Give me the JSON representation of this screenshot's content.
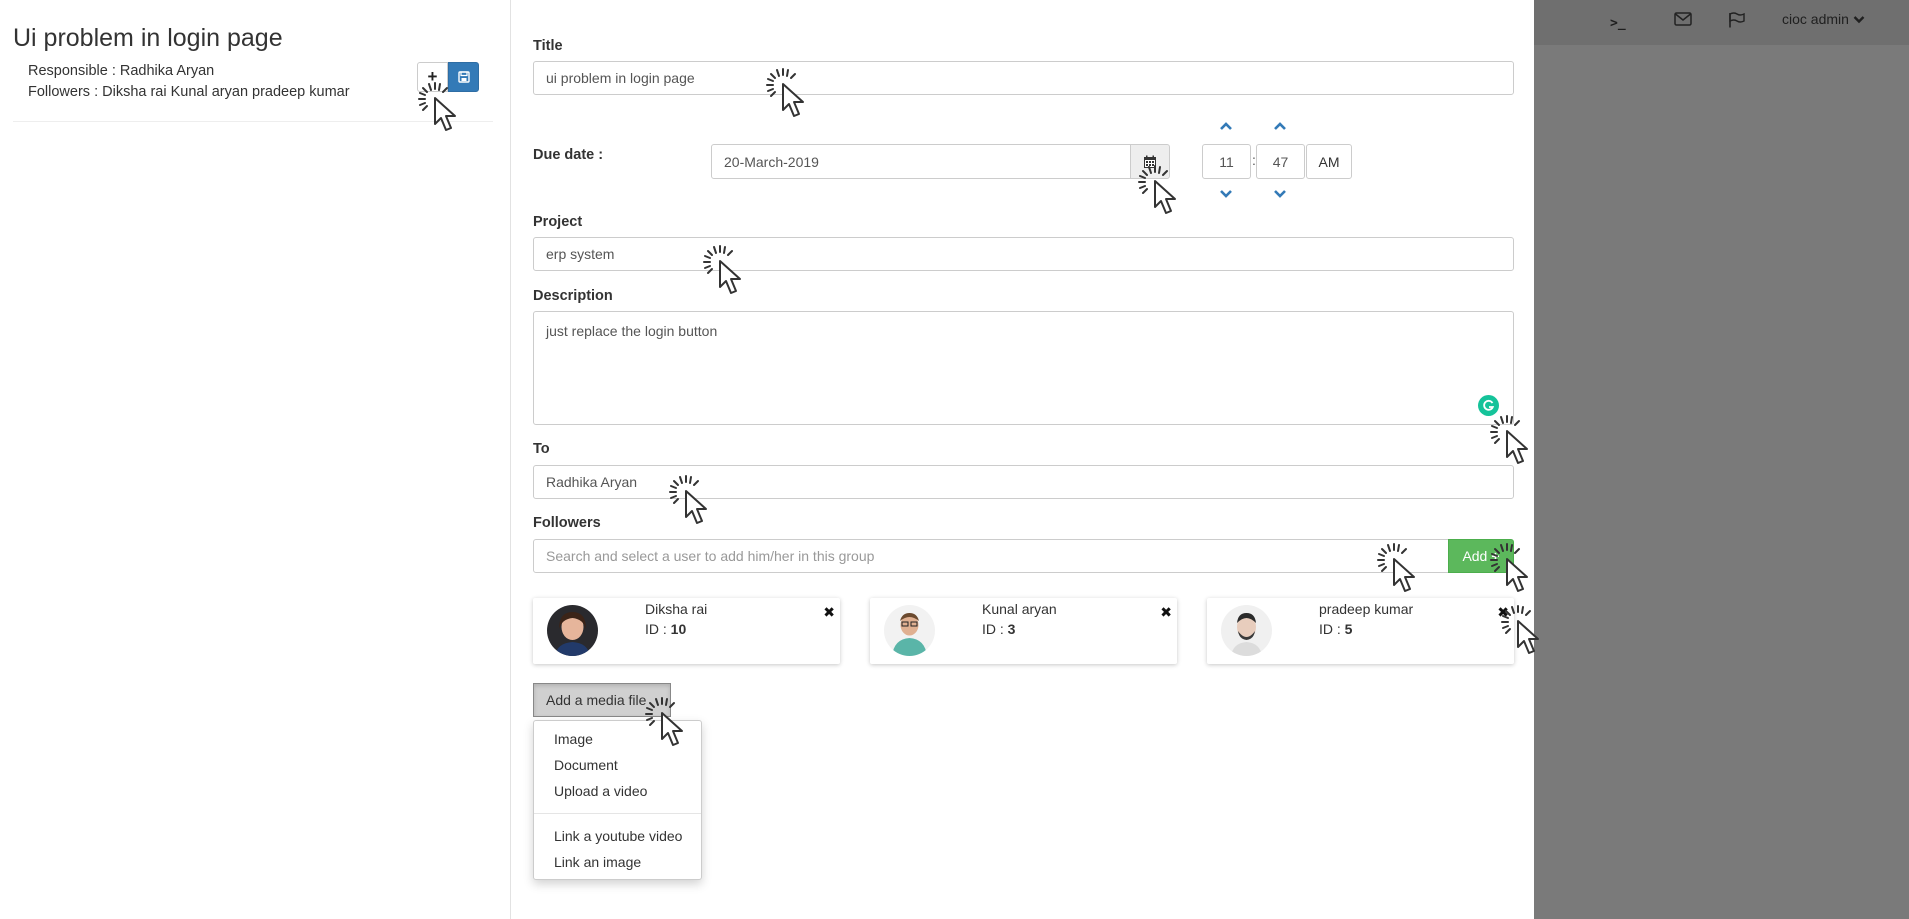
{
  "left": {
    "title": "Ui problem in login page",
    "responsible": "Responsible : Radhika Aryan",
    "followers": "Followers : Diksha rai Kunal aryan pradeep kumar",
    "plus_label": "+"
  },
  "form": {
    "title_label": "Title",
    "title_value": "ui problem in login page",
    "due_label": "Due date :",
    "due_value": "20-March-2019",
    "hour": "11",
    "minute": "47",
    "ampm": "AM",
    "time_sep": ":",
    "project_label": "Project",
    "project_value": "erp system",
    "description_label": "Description",
    "description_value": "just replace the login button",
    "to_label": "To",
    "to_value": "Radhika  Aryan",
    "followers_label": "Followers",
    "followers_placeholder": "Search and select a user to add him/her in this group",
    "add_label": "Add",
    "add_icon": "+"
  },
  "followers": [
    {
      "name": "Diksha rai",
      "id_label": "ID : ",
      "id": "10"
    },
    {
      "name": "Kunal aryan",
      "id_label": "ID : ",
      "id": "3"
    },
    {
      "name": "pradeep kumar",
      "id_label": "ID : ",
      "id": "5"
    }
  ],
  "close_glyph": "✖",
  "media": {
    "button_label": "Add a media file",
    "items": [
      "Image",
      "Document",
      "Upload a video",
      "Link a youtube video",
      "Link an image"
    ]
  },
  "topbar": {
    "terminal_glyph": ">_",
    "user": "cioc admin"
  },
  "colors": {
    "primary": "#337ab7",
    "success": "#5cb85c",
    "overlay": "#7a7a7a",
    "grammarly": "#15c39a"
  }
}
